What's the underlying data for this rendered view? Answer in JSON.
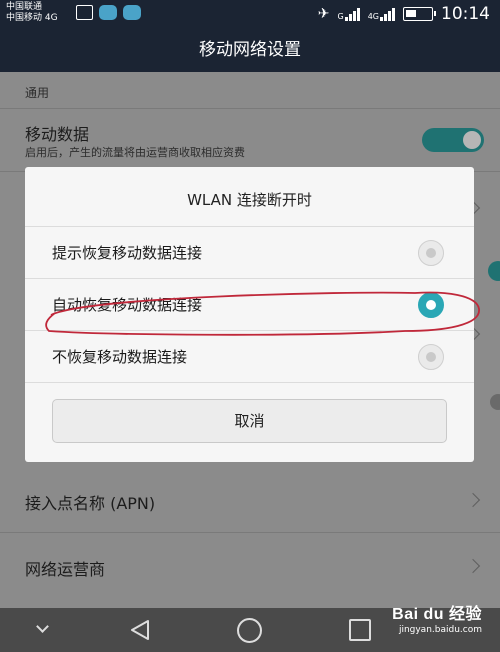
{
  "status_bar": {
    "carrier_1": "中国联通",
    "carrier_2": "中国移动 4G",
    "signal_1_label": "G",
    "signal_2_label": "4G",
    "time": "10:14"
  },
  "header": {
    "title": "移动网络设置"
  },
  "settings": {
    "section_general": "通用",
    "mobile_data": {
      "title": "移动数据",
      "subtitle": "启用后，产生的流量将由运营商收取相应资费",
      "enabled": true
    },
    "apn": {
      "title": "接入点名称 (APN)"
    },
    "carrier": {
      "title": "网络运营商"
    }
  },
  "dialog": {
    "title": "WLAN 连接断开时",
    "options": [
      {
        "label": "提示恢复移动数据连接",
        "selected": false
      },
      {
        "label": "自动恢复移动数据连接",
        "selected": true
      },
      {
        "label": "不恢复移动数据连接",
        "selected": false
      }
    ],
    "cancel_label": "取消"
  },
  "watermark": {
    "logo": "Bai du 经验",
    "url": "jingyan.baidu.com"
  },
  "colors": {
    "accent": "#2aa7b5",
    "bar": "#1b2433",
    "annotation": "#c0283a"
  }
}
